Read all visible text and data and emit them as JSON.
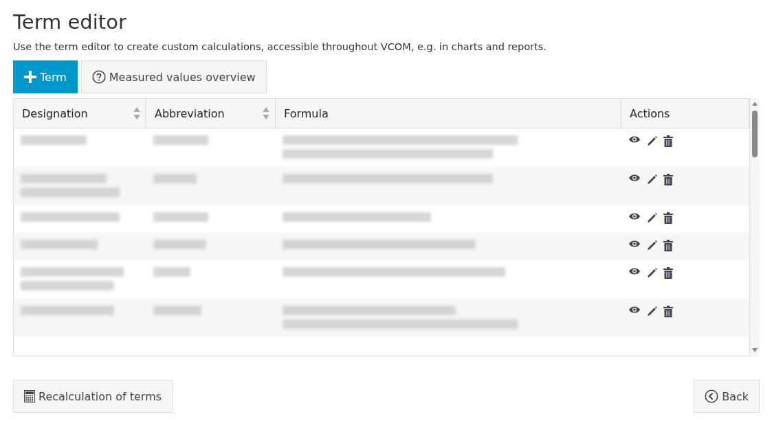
{
  "title": "Term editor",
  "description": "Use the term editor to create custom calculations, accessible throughout VCOM, e.g. in charts and reports.",
  "toolbar": [
    {
      "label": "Term",
      "kind": "primary"
    },
    {
      "label": "Measured values overview",
      "kind": "help"
    }
  ],
  "table": {
    "columns": [
      {
        "label": "Designation",
        "sortable": true
      },
      {
        "label": "Abbreviation",
        "sortable": true
      },
      {
        "label": "Formula",
        "sortable": false
      },
      {
        "label": "Actions",
        "sortable": false
      }
    ],
    "rows": [
      {
        "designation": [
          {
            "redacted": true
          }
        ],
        "abbreviation": [
          {
            "redacted": true
          }
        ],
        "formula": [
          {
            "redacted": true
          },
          {
            "redacted": true
          }
        ]
      },
      {
        "designation": [
          {
            "redacted": true
          },
          {
            "redacted": true
          }
        ],
        "abbreviation": [
          {
            "redacted": true
          }
        ],
        "formula": [
          {
            "redacted": true
          }
        ]
      },
      {
        "designation": [
          {
            "redacted": true
          }
        ],
        "abbreviation": [
          {
            "redacted": true
          }
        ],
        "formula": [
          {
            "redacted": true
          }
        ]
      },
      {
        "designation": [
          {
            "redacted": true
          }
        ],
        "abbreviation": [
          {
            "redacted": true
          }
        ],
        "formula": [
          {
            "redacted": true
          }
        ]
      },
      {
        "designation": [
          {
            "redacted": true
          },
          {
            "redacted": true
          }
        ],
        "abbreviation": [
          {
            "redacted": true
          }
        ],
        "formula": [
          {
            "redacted": true
          }
        ]
      },
      {
        "designation": [
          {
            "redacted": true
          }
        ],
        "abbreviation": [
          {
            "redacted": true
          }
        ],
        "formula": [
          {
            "redacted": true
          },
          {
            "redacted": true
          }
        ]
      }
    ]
  },
  "footer": [
    {
      "label": "Recalculation of terms",
      "kind": "calculator"
    },
    {
      "label": "Back",
      "kind": "back"
    }
  ]
}
